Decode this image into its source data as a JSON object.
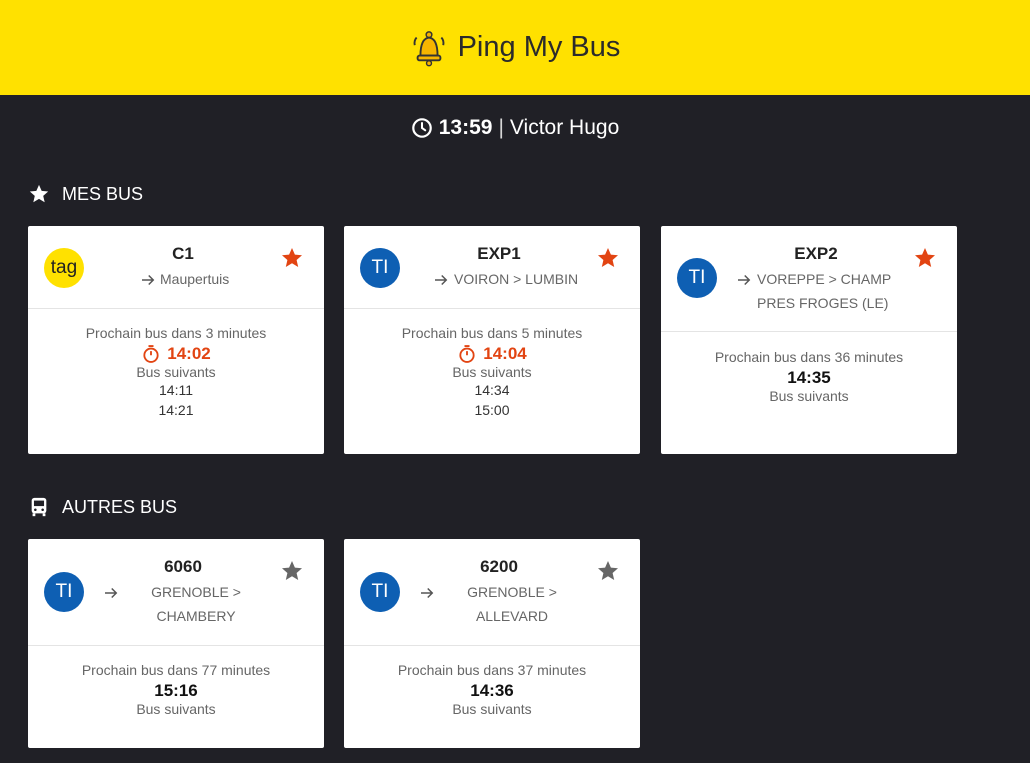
{
  "header": {
    "title": "Ping My Bus",
    "icon": "bell-icon"
  },
  "status": {
    "time": "13:59",
    "separator": "|",
    "stop": "Victor Hugo"
  },
  "sections": {
    "mine": "MES BUS",
    "others": "AUTRES BUS"
  },
  "colors": {
    "accent": "#ffe100",
    "background": "#202026",
    "alert": "#e24412",
    "ti_blue": "#0e5fb3"
  },
  "cards": [
    {
      "network": "tag",
      "line": "C1",
      "dest": "Maupertuis",
      "favorite": true,
      "next_label": "Prochain bus dans 3 minutes",
      "next_time": "14:02",
      "alert": true,
      "following_label": "Bus suivants",
      "following": [
        "14:11",
        "14:21"
      ]
    },
    {
      "network": "TI",
      "line": "EXP1",
      "dest": "VOIRON > LUMBIN",
      "favorite": true,
      "next_label": "Prochain bus dans 5 minutes",
      "next_time": "14:04",
      "alert": true,
      "following_label": "Bus suivants",
      "following": [
        "14:34",
        "15:00"
      ]
    },
    {
      "network": "TI",
      "line": "EXP2",
      "dest_line1": "VOREPPE > CHAMP",
      "dest_line2": "PRES FROGES (LE)",
      "favorite": true,
      "next_label": "Prochain bus dans 36 minutes",
      "next_time": "14:35",
      "alert": false,
      "following_label": "Bus suivants",
      "following": []
    },
    {
      "network": "TI",
      "line": "6060",
      "dest_line1": "GRENOBLE >",
      "dest_line2": "CHAMBERY",
      "favorite": false,
      "next_label": "Prochain bus dans 77 minutes",
      "next_time": "15:16",
      "alert": false,
      "following_label": "Bus suivants",
      "following": []
    },
    {
      "network": "TI",
      "line": "6200",
      "dest_line1": "GRENOBLE >",
      "dest_line2": "ALLEVARD",
      "favorite": false,
      "next_label": "Prochain bus dans 37 minutes",
      "next_time": "14:36",
      "alert": false,
      "following_label": "Bus suivants",
      "following": []
    }
  ]
}
